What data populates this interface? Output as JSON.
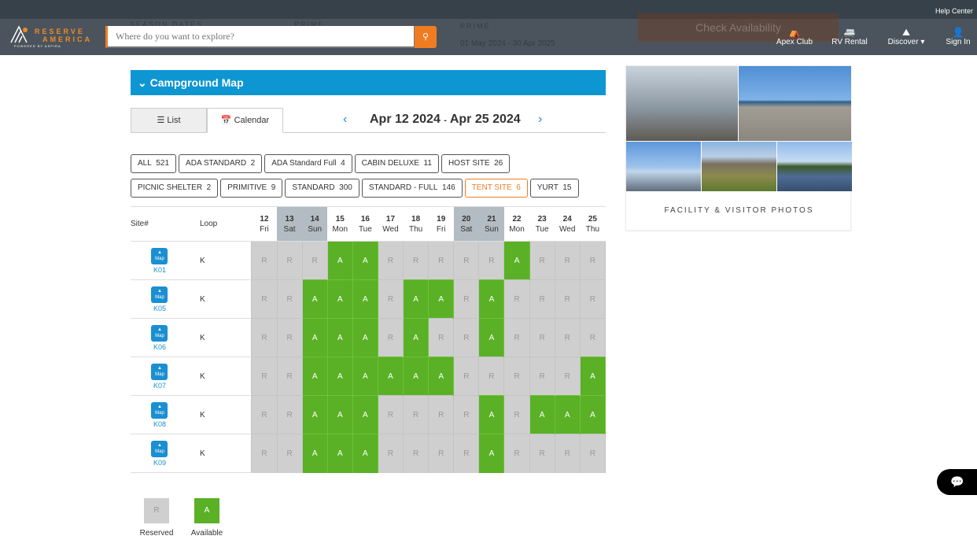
{
  "header": {
    "help_center": "Help Center",
    "logo": {
      "line1": "RESERVE",
      "line2": "AMERICA",
      "line3": "POWERED BY ASPIRA"
    },
    "search_placeholder": "Where do you want to explore?",
    "behind": {
      "season_dates": "SEASON DATES",
      "prime1": "PRIME",
      "prime2": "PRIME",
      "dates": "01 May 2024 - 30 Apr 2025",
      "check": "Check Availability"
    },
    "nav": [
      {
        "label": "Apex Club",
        "icon": "tent-icon"
      },
      {
        "label": "RV Rental",
        "icon": "rv-icon"
      },
      {
        "label": "Discover ▾",
        "icon": "mountain-icon"
      },
      {
        "label": "Sign In",
        "icon": "user-icon"
      }
    ]
  },
  "panel": {
    "title": "Campground Map"
  },
  "tabs": {
    "list": "List",
    "calendar": "Calendar"
  },
  "date_range": {
    "start": "Apr 12 2024",
    "sep": "-",
    "end": "Apr 25 2024"
  },
  "filters": [
    {
      "label": "ALL",
      "count": "521"
    },
    {
      "label": "ADA STANDARD",
      "count": "2"
    },
    {
      "label": "ADA Standard Full",
      "count": "4"
    },
    {
      "label": "CABIN DELUXE",
      "count": "11"
    },
    {
      "label": "HOST SITE",
      "count": "26"
    },
    {
      "label": "PICNIC SHELTER",
      "count": "2"
    },
    {
      "label": "PRIMITIVE",
      "count": "9"
    },
    {
      "label": "STANDARD",
      "count": "300"
    },
    {
      "label": "STANDARD - FULL",
      "count": "146"
    },
    {
      "label": "TENT SITE",
      "count": "6",
      "active": true
    },
    {
      "label": "YURT",
      "count": "15"
    }
  ],
  "grid": {
    "site_header": "Site#",
    "loop_header": "Loop",
    "map_label": "Map",
    "days": [
      {
        "n": "12",
        "d": "Fri"
      },
      {
        "n": "13",
        "d": "Sat",
        "we": true
      },
      {
        "n": "14",
        "d": "Sun",
        "we": true
      },
      {
        "n": "15",
        "d": "Mon"
      },
      {
        "n": "16",
        "d": "Tue"
      },
      {
        "n": "17",
        "d": "Wed"
      },
      {
        "n": "18",
        "d": "Thu"
      },
      {
        "n": "19",
        "d": "Fri"
      },
      {
        "n": "20",
        "d": "Sat",
        "we": true
      },
      {
        "n": "21",
        "d": "Sun",
        "we": true
      },
      {
        "n": "22",
        "d": "Mon"
      },
      {
        "n": "23",
        "d": "Tue"
      },
      {
        "n": "24",
        "d": "Wed"
      },
      {
        "n": "25",
        "d": "Thu"
      }
    ],
    "rows": [
      {
        "site": "K01",
        "loop": "K",
        "cells": [
          "R",
          "R",
          "R",
          "A",
          "A",
          "R",
          "R",
          "R",
          "R",
          "R",
          "A",
          "R",
          "R",
          "R"
        ]
      },
      {
        "site": "K05",
        "loop": "K",
        "cells": [
          "R",
          "R",
          "A",
          "A",
          "A",
          "R",
          "A",
          "A",
          "R",
          "A",
          "R",
          "R",
          "R",
          "R"
        ]
      },
      {
        "site": "K06",
        "loop": "K",
        "cells": [
          "R",
          "R",
          "A",
          "A",
          "A",
          "R",
          "A",
          "R",
          "R",
          "A",
          "R",
          "R",
          "R",
          "R"
        ]
      },
      {
        "site": "K07",
        "loop": "K",
        "cells": [
          "R",
          "R",
          "A",
          "A",
          "A",
          "A",
          "A",
          "A",
          "R",
          "R",
          "R",
          "R",
          "R",
          "A"
        ]
      },
      {
        "site": "K08",
        "loop": "K",
        "cells": [
          "R",
          "R",
          "A",
          "A",
          "A",
          "R",
          "R",
          "R",
          "R",
          "A",
          "R",
          "A",
          "A",
          "A"
        ]
      },
      {
        "site": "K09",
        "loop": "K",
        "cells": [
          "R",
          "R",
          "A",
          "A",
          "A",
          "R",
          "R",
          "R",
          "R",
          "A",
          "R",
          "R",
          "R",
          "R"
        ]
      }
    ]
  },
  "legend": {
    "reserved_code": "R",
    "reserved": "Reserved",
    "available_code": "A",
    "available": "Available"
  },
  "photos": {
    "caption": "FACILITY & VISITOR PHOTOS"
  },
  "colors": {
    "accent": "#0e96d2",
    "orange": "#f07c22",
    "available": "#5ab126",
    "reserved": "#cfcfcf"
  }
}
